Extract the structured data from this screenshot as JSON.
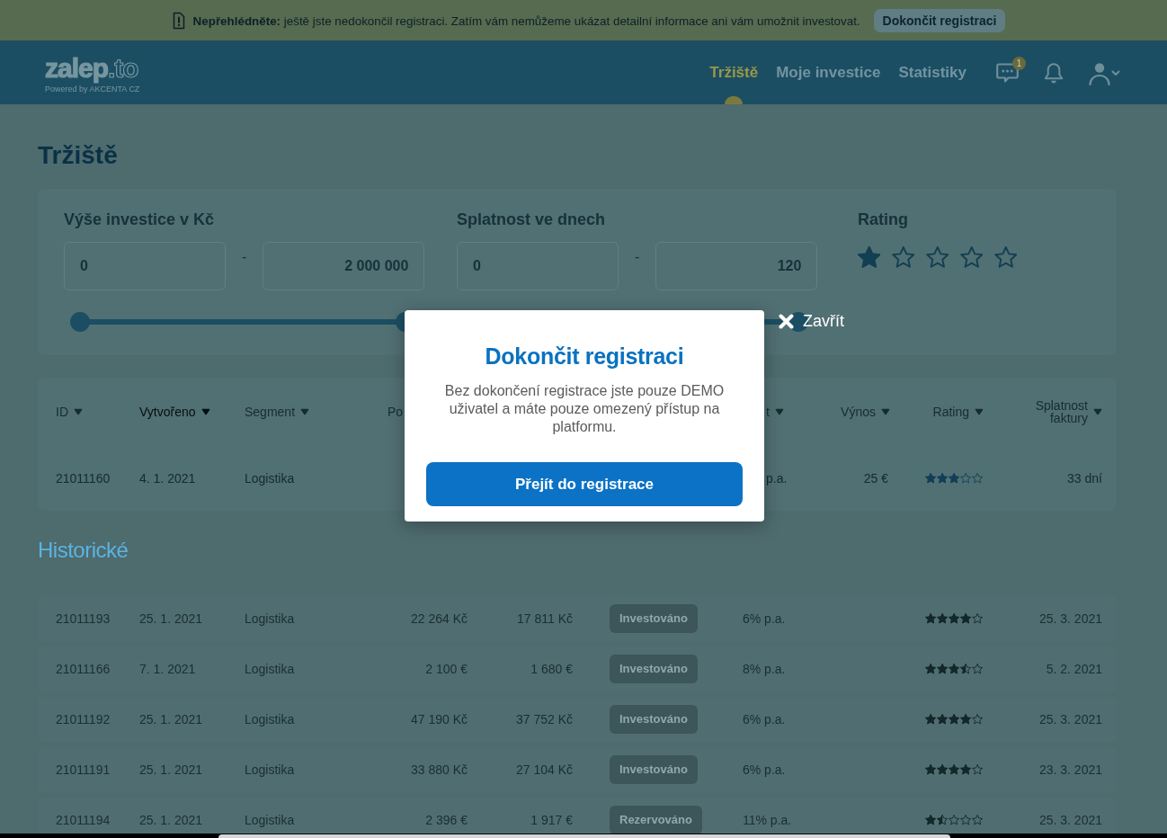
{
  "notice_bar": {
    "message": "**Nepřehlédněte:** ještě jste nedokončil registraci. Zatím vám nemůžeme ukázat detailní informace ani vám umožnit investovat.",
    "button": "Dokončit registraci"
  },
  "header": {
    "logo": "**zalep**.to",
    "tagline": "Powered by AKCENTA CZ",
    "nav": [
      {
        "label": "Tržiště",
        "selected": true
      },
      {
        "label": "Moje investice",
        "selected": false
      },
      {
        "label": "Statistiky",
        "selected": false
      }
    ],
    "messages_badge": "1"
  },
  "page_title": "Tržiště",
  "filters": [
    {
      "kind": "range",
      "label": "Výše investice v Kč",
      "min_value": "0",
      "separator": "-",
      "max_value": "2 000 000",
      "thumbs": [
        {
          "level": 0
        },
        {
          "level": 1
        }
      ]
    },
    {
      "kind": "range",
      "label": "Splatnost ve dnech",
      "min_value": "0",
      "separator": "-",
      "max_value": "120",
      "thumbs": [
        {
          "level": 1
        }
      ]
    },
    {
      "kind": "rating",
      "label": "Rating",
      "stars": 1
    }
  ],
  "market_table": {
    "columns": [
      {
        "label": "ID",
        "selected": false,
        "sort_icon": true
      },
      {
        "label": "Vytvořeno",
        "selected": true,
        "sort_icon": true
      },
      {
        "label": "Segment",
        "selected": false,
        "sort_icon": true
      },
      {
        "label": "Po",
        "selected": false,
        "sort_icon": false
      },
      {
        "label": "t",
        "selected": false,
        "sort_icon": true
      },
      {
        "label": "Výnos",
        "selected": false,
        "sort_icon": true
      },
      {
        "label": "Rating",
        "selected": false,
        "sort_icon": true
      },
      {
        "label": "Splatnost faktury",
        "selected": false,
        "sort_icon": true
      }
    ],
    "rows": [
      {
        "id": "21011160",
        "created": "4. 1. 2021",
        "segment": "Logistika",
        "column_5": "p.a.",
        "vynos": "25 €",
        "stars": 3,
        "due": "33 dní"
      }
    ]
  },
  "history": {
    "title": "Historické",
    "rows": [
      {
        "id": "21011193",
        "created": "25. 1. 2021",
        "segment": "Logistika",
        "amount": "22 264 Kč",
        "amount_2": "17 811 Kč",
        "status": "Investováno",
        "rate": "6% p.a.",
        "stars": 4,
        "due": "25. 3. 2021"
      },
      {
        "id": "21011166",
        "created": "7. 1. 2021",
        "segment": "Logistika",
        "amount": "2 100 €",
        "amount_2": "1 680 €",
        "status": "Investováno",
        "rate": "8% p.a.",
        "stars": 3.5,
        "due": "5. 2. 2021"
      },
      {
        "id": "21011192",
        "created": "25. 1. 2021",
        "segment": "Logistika",
        "amount": "47 190 Kč",
        "amount_2": "37 752 Kč",
        "status": "Investováno",
        "rate": "6% p.a.",
        "stars": 4,
        "due": "25. 3. 2021"
      },
      {
        "id": "21011191",
        "created": "25. 1. 2021",
        "segment": "Logistika",
        "amount": "33 880 Kč",
        "amount_2": "27 104 Kč",
        "status": "Investováno",
        "rate": "6% p.a.",
        "stars": 4,
        "due": "23. 3. 2021"
      },
      {
        "id": "21011194",
        "created": "25. 1. 2021",
        "segment": "Logistika",
        "amount": "2 396 €",
        "amount_2": "1 917 €",
        "status": "Rezervováno",
        "rate": "11% p.a.",
        "stars": 1.5,
        "due": "25. 3. 2021"
      }
    ]
  },
  "dialog": {
    "close": "Zavřít",
    "title": "Dokončit registraci",
    "text": "Bez dokončení registrace jste pouze DEMO uživatel a máte pouze omezený přístup na platformu.",
    "button": "Přejít do registrace"
  }
}
